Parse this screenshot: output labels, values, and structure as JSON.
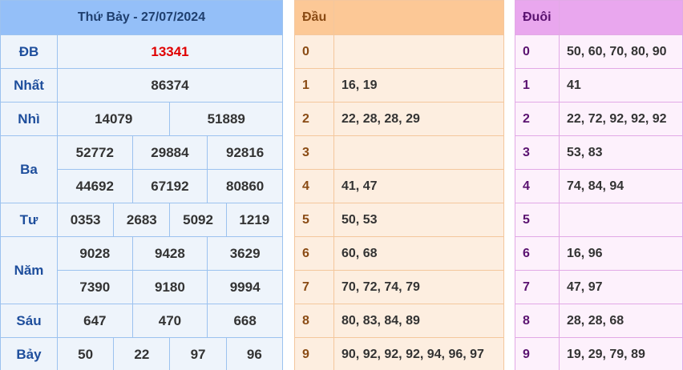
{
  "results": {
    "date_title": "Thứ Bảy - 27/07/2024",
    "prizes": [
      {
        "label": "ĐB",
        "rows": [
          [
            "13341"
          ]
        ]
      },
      {
        "label": "Nhất",
        "rows": [
          [
            "86374"
          ]
        ]
      },
      {
        "label": "Nhì",
        "rows": [
          [
            "14079",
            "51889"
          ]
        ]
      },
      {
        "label": "Ba",
        "rows": [
          [
            "52772",
            "29884",
            "92816"
          ],
          [
            "44692",
            "67192",
            "80860"
          ]
        ]
      },
      {
        "label": "Tư",
        "rows": [
          [
            "0353",
            "2683",
            "5092",
            "1219"
          ]
        ]
      },
      {
        "label": "Năm",
        "rows": [
          [
            "9028",
            "9428",
            "3629"
          ],
          [
            "7390",
            "9180",
            "9994"
          ]
        ]
      },
      {
        "label": "Sáu",
        "rows": [
          [
            "647",
            "470",
            "668"
          ]
        ]
      },
      {
        "label": "Bảy",
        "rows": [
          [
            "50",
            "22",
            "97",
            "96"
          ]
        ]
      }
    ]
  },
  "dau": {
    "header": "Đầu",
    "rows": [
      {
        "key": "0",
        "value": ""
      },
      {
        "key": "1",
        "value": "16, 19"
      },
      {
        "key": "2",
        "value": "22, 28, 28, 29"
      },
      {
        "key": "3",
        "value": ""
      },
      {
        "key": "4",
        "value": "41, 47"
      },
      {
        "key": "5",
        "value": "50, 53"
      },
      {
        "key": "6",
        "value": "60, 68"
      },
      {
        "key": "7",
        "value": "70, 72, 74, 79"
      },
      {
        "key": "8",
        "value": "80, 83, 84, 89"
      },
      {
        "key": "9",
        "value": "90, 92, 92, 92, 94, 96, 97"
      }
    ]
  },
  "duoi": {
    "header": "Đuôi",
    "rows": [
      {
        "key": "0",
        "value": "50, 60, 70, 80, 90"
      },
      {
        "key": "1",
        "value": "41"
      },
      {
        "key": "2",
        "value": "22, 72, 92, 92, 92"
      },
      {
        "key": "3",
        "value": "53, 83"
      },
      {
        "key": "4",
        "value": "74, 84, 94"
      },
      {
        "key": "5",
        "value": ""
      },
      {
        "key": "6",
        "value": "16, 96"
      },
      {
        "key": "7",
        "value": "47, 97"
      },
      {
        "key": "8",
        "value": "28, 28, 68"
      },
      {
        "key": "9",
        "value": "19, 29, 79, 89"
      }
    ]
  },
  "colors": {
    "special_prize": "#e00000",
    "results_header": "#94bff8",
    "dau_header": "#fcc896",
    "duoi_header": "#e9a7ee"
  }
}
